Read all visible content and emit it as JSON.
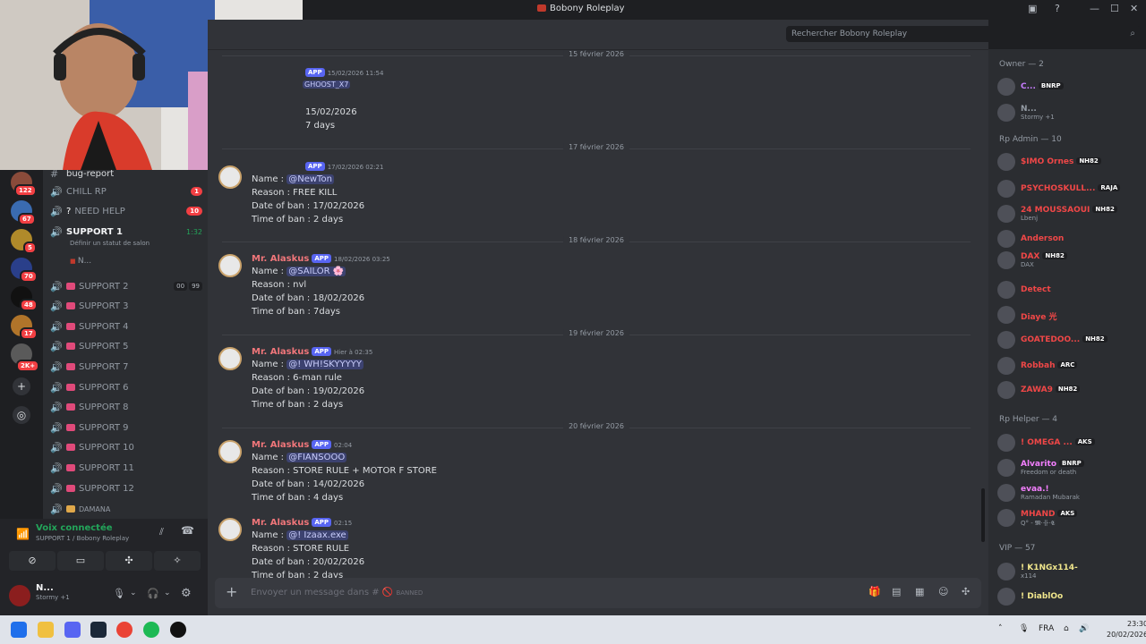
{
  "window": {
    "title": "Bobony Roleplay"
  },
  "search": {
    "placeholder": "Rechercher Bobony Roleplay"
  },
  "guild_badges": [
    "122",
    "67",
    "5",
    "70",
    "48",
    "17",
    "2K+"
  ],
  "channels": {
    "top_partial": "bug-report",
    "items": [
      {
        "name": "CHILL RP",
        "badge": "1"
      },
      {
        "name": "NEED HELP",
        "badge": "10"
      },
      {
        "name": "SUPPORT 1",
        "timer": "1:32",
        "status": "Définir un statut de salon",
        "member": "N..."
      },
      {
        "name": "SUPPORT 2",
        "counts": [
          "00",
          "99"
        ]
      },
      {
        "name": "SUPPORT 3"
      },
      {
        "name": "SUPPORT 4"
      },
      {
        "name": "SUPPORT 5"
      },
      {
        "name": "SUPPORT 7"
      },
      {
        "name": "SUPPORT 6"
      },
      {
        "name": "SUPPORT 8"
      },
      {
        "name": "SUPPORT 9"
      },
      {
        "name": "SUPPORT 10"
      },
      {
        "name": "SUPPORT 11"
      },
      {
        "name": "SUPPORT 12"
      },
      {
        "name": "DAMANA"
      }
    ]
  },
  "voice": {
    "status": "Voix connectée",
    "channel": "SUPPORT 1 / Bobony Roleplay"
  },
  "user": {
    "name": "N...",
    "status": "Stormy +1"
  },
  "messages": {
    "dividers": [
      "15 février 2026",
      "17 février 2026",
      "18 février 2026",
      "19 février 2026",
      "20 février 2026"
    ],
    "first_partial": {
      "timestamp": "15/02/2026 11:54",
      "name_tail": "GHOOST_X7",
      "date": "15/02/2026",
      "time": "7 days"
    },
    "items": [
      {
        "author": "Mr. Alaskus",
        "timestamp": "17/02/2026 02:21",
        "name": "@NewTon",
        "reason": "Reason : FREE KILL",
        "date": "Date of ban : 17/02/2026",
        "time": "Time of ban : 2 days"
      },
      {
        "author": "Mr. Alaskus",
        "timestamp": "18/02/2026 03:25",
        "name": "@SAILOR 🌸",
        "reason": "Reason : nvl",
        "date": "Date of ban : 18/02/2026",
        "time": "Time of ban : 7days"
      },
      {
        "author": "Mr. Alaskus",
        "timestamp": "Hier à 02:35",
        "name": "@! WH!SKYYYYY",
        "reason": "Reason : 6-man rule",
        "date": "Date of ban : 19/02/2026",
        "time": "Time of ban : 2 days"
      },
      {
        "author": "Mr. Alaskus",
        "timestamp": "02:04",
        "name": "@FIANSOOO",
        "reason": "Reason : STORE RULE + MOTOR F STORE",
        "date": "Date of ban : 14/02/2026",
        "time": "Time of ban : 4 days"
      },
      {
        "author": "Mr. Alaskus",
        "timestamp": "02:15",
        "name": "@! Izaax.exe",
        "reason": "Reason : STORE RULE",
        "date": "Date of ban : 20/02/2026",
        "time": "Time of ban : 2 days"
      }
    ],
    "app_label": "APP",
    "name_prefix": "Name : "
  },
  "composer": {
    "placeholder": "Envoyer un message dans #",
    "channel": "BANNED"
  },
  "members": {
    "groups": [
      {
        "title": "Owner — 2",
        "items": [
          {
            "name": "C...",
            "badge": "BNRP",
            "color": "#c77dff"
          },
          {
            "name": "N...",
            "sub": "Stormy +1",
            "color": "#949ba4"
          }
        ]
      },
      {
        "title": "Rp Admin — 10",
        "items": [
          {
            "name": "$IMO Ornes",
            "badge": "NH82",
            "color": "#f04747"
          },
          {
            "name": "PSYCHOSKULL...",
            "badge": "RAJA",
            "color": "#f04747"
          },
          {
            "name": "24 MOUSSAOUI",
            "badge": "NH82",
            "sub": "Lbenj",
            "color": "#f04747"
          },
          {
            "name": "Anderson",
            "color": "#f04747"
          },
          {
            "name": "DAX",
            "badge": "NH82",
            "sub": "DAX",
            "color": "#f04747"
          },
          {
            "name": "Detect",
            "color": "#f04747"
          },
          {
            "name": "Diaye 光",
            "color": "#f04747"
          },
          {
            "name": "GOATEDOO...",
            "badge": "NH82",
            "color": "#f04747"
          },
          {
            "name": "Robbah",
            "badge": "ARC",
            "color": "#f04747"
          },
          {
            "name": "ZAWA9",
            "badge": "NH82",
            "color": "#f04747"
          }
        ]
      },
      {
        "title": "Rp Helper — 4",
        "items": [
          {
            "name": "! OMEGA ...",
            "badge": "AKS",
            "color": "#f04747"
          },
          {
            "name": "Alvarito",
            "badge": "BNRP",
            "sub": "Freedom or death",
            "color": "#f47fff"
          },
          {
            "name": "evaa.!",
            "sub": "Ramadan Mubarak",
            "color": "#f47fff"
          },
          {
            "name": "MHAND",
            "badge": "AKS",
            "sub": "Q° - 𝕸·卝·𝕮",
            "color": "#f04747"
          }
        ]
      },
      {
        "title": "VIP — 57",
        "items": [
          {
            "name": "! K1NGx114-",
            "sub": "x114",
            "color": "#f0e68c"
          },
          {
            "name": "! DiablOo",
            "color": "#f0e68c"
          }
        ]
      }
    ]
  },
  "taskbar": {
    "lang": "FRA",
    "time": "23:30",
    "date": "20/02/2026"
  },
  "colors": {
    "accent": "#5865f2",
    "author": "#f0767a",
    "danger": "#f23f43"
  }
}
